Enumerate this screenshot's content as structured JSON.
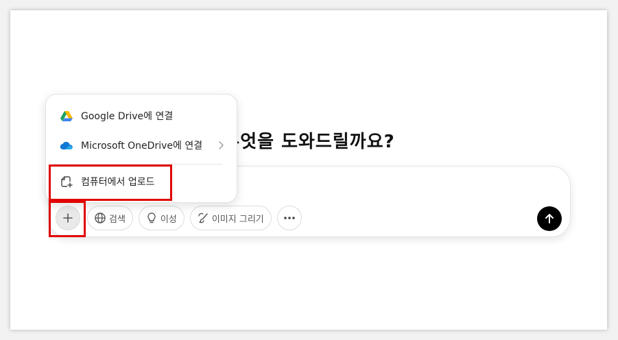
{
  "main": {
    "heading": "무엇을 도와드릴까요?"
  },
  "menu": {
    "items": [
      {
        "label": "Google Drive에 연결",
        "icon": "google-drive-icon"
      },
      {
        "label": "Microsoft OneDrive에 연결",
        "icon": "onedrive-icon",
        "has_submenu": true
      },
      {
        "label": "컴퓨터에서 업로드",
        "icon": "upload-file-icon"
      }
    ]
  },
  "toolbar": {
    "plus_icon": "plus-icon",
    "chips": [
      {
        "label": "검색",
        "icon": "globe-icon"
      },
      {
        "label": "이성",
        "icon": "lightbulb-icon"
      },
      {
        "label": "이미지 그리기",
        "icon": "paint-brush-icon"
      }
    ],
    "more_icon": "more-icon",
    "send_icon": "arrow-up-icon"
  },
  "colors": {
    "highlight": "#e00000",
    "send_button": "#000000",
    "drive_green": "#1ea362",
    "drive_yellow": "#ffba00",
    "drive_blue": "#4285f4",
    "onedrive_blue": "#0f78d4"
  }
}
